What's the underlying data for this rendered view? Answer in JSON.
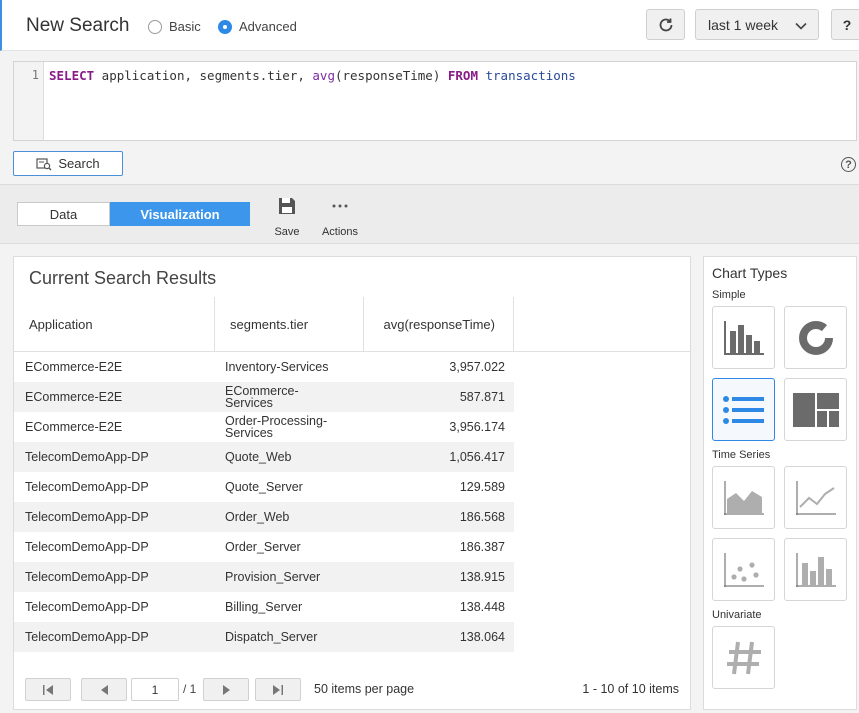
{
  "header": {
    "title": "New Search",
    "mode_basic": "Basic",
    "mode_advanced": "Advanced",
    "time_range": "last 1 week",
    "help_label": "?"
  },
  "editor": {
    "line_number": "1",
    "kw_select": "SELECT",
    "cols": " application, segments.tier, ",
    "fn": "avg",
    "fn_arg": "(responseTime) ",
    "kw_from": "FROM",
    "table": " transactions"
  },
  "search_button": "Search",
  "view_tabs": {
    "data": "Data",
    "visualization": "Visualization"
  },
  "toolbar": {
    "save": "Save",
    "actions": "Actions"
  },
  "results": {
    "title": "Current Search Results",
    "columns": [
      "Application",
      "segments.tier",
      "avg(responseTime)"
    ],
    "rows": [
      [
        "ECommerce-E2E",
        "Inventory-Services",
        "3,957.022"
      ],
      [
        "ECommerce-E2E",
        "ECommerce-Services",
        "587.871"
      ],
      [
        "ECommerce-E2E",
        "Order-Processing-Services",
        "3,956.174"
      ],
      [
        "TelecomDemoApp-DP",
        "Quote_Web",
        "1,056.417"
      ],
      [
        "TelecomDemoApp-DP",
        "Quote_Server",
        "129.589"
      ],
      [
        "TelecomDemoApp-DP",
        "Order_Web",
        "186.568"
      ],
      [
        "TelecomDemoApp-DP",
        "Order_Server",
        "186.387"
      ],
      [
        "TelecomDemoApp-DP",
        "Provision_Server",
        "138.915"
      ],
      [
        "TelecomDemoApp-DP",
        "Billing_Server",
        "138.448"
      ],
      [
        "TelecomDemoApp-DP",
        "Dispatch_Server",
        "138.064"
      ]
    ]
  },
  "pager": {
    "page_value": "1",
    "page_total": "/ 1",
    "per_page": "50 items per page",
    "range": "1 - 10 of 10 items"
  },
  "chart_types": {
    "title": "Chart Types",
    "simple": "Simple",
    "time_series": "Time Series",
    "univariate": "Univariate"
  },
  "colors": {
    "accent": "#2d89e5",
    "icon_gray": "#6b6b6b"
  }
}
